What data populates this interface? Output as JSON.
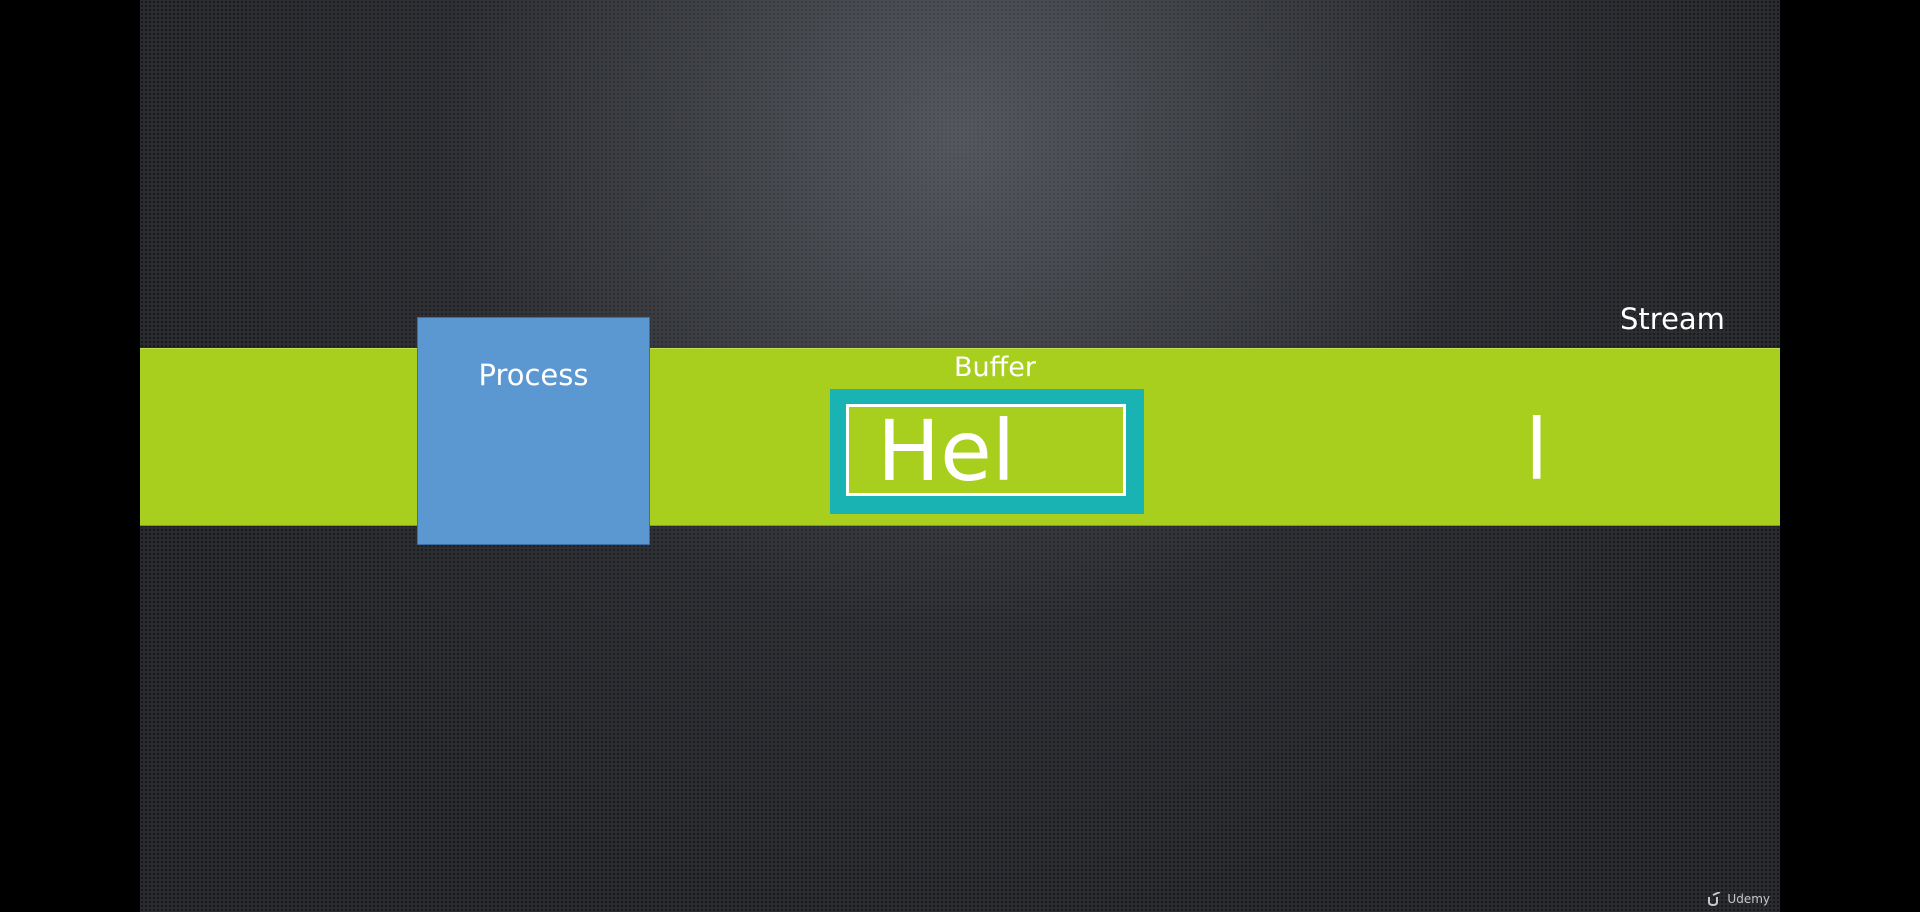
{
  "slide": {
    "stream_label": "Stream",
    "process_label": "Process",
    "buffer_label": "Buffer",
    "buffer_content": "Hel",
    "stream_char": "l",
    "watermark": "Udemy"
  },
  "colors": {
    "stream_band": "#a8cf1e",
    "process_box": "#5b97d1",
    "buffer_frame": "#1ab3b3",
    "text": "#ffffff"
  }
}
